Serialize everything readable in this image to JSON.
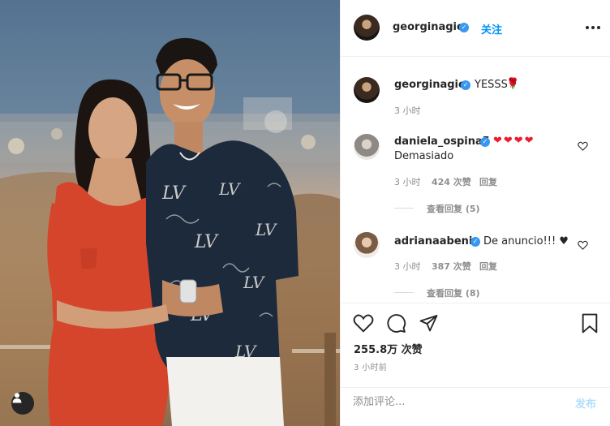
{
  "post": {
    "author": {
      "username": "georginagio",
      "verified": true,
      "follow_label": "关注",
      "dot": "•"
    },
    "caption": {
      "username": "georginagio",
      "text": "YESSS",
      "emoji": "🌹",
      "time": "3 小时"
    },
    "comments": [
      {
        "username": "daniela_ospina5",
        "text": "Demasiado",
        "hearts": "❤❤❤❤",
        "time": "3 小时",
        "likes": "424 次赞",
        "reply_label": "回复",
        "view_replies": "查看回复 (5)"
      },
      {
        "username": "adrianaabenia",
        "text": "De anuncio!!! ♥",
        "time": "3 小时",
        "likes": "387 次赞",
        "reply_label": "回复",
        "view_replies": "查看回复 (8)"
      }
    ],
    "likes_count": "255.8万 次赞",
    "posted_ago": "3 小时前",
    "comment_box": {
      "placeholder": "添加评论...",
      "post_label": "发布"
    }
  },
  "icons": {
    "heart": "heart-icon",
    "comment": "comment-icon",
    "share": "paper-plane-icon",
    "save": "bookmark-icon",
    "more": "more-options-icon",
    "user_tag": "user-tag-icon",
    "verified": "verified-badge-icon"
  },
  "colors": {
    "link_blue": "#0095f6",
    "verified_blue": "#3897f0",
    "muted_gray": "#8e8e8e",
    "text_dark": "#262626",
    "post_disabled": "#b2dffc"
  }
}
